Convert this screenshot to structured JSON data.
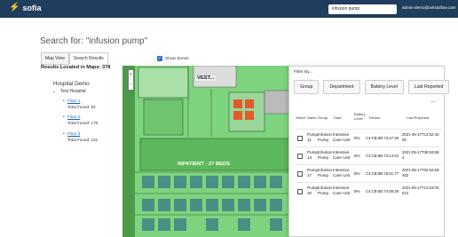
{
  "app": {
    "logo": "sofia",
    "search_value": "infusion pump",
    "user_email": "admin-demo@airistaflow.com"
  },
  "page": {
    "heading": "Search for: \"infusion pump\"",
    "tabs": [
      "Map View",
      "Search Results"
    ],
    "results_located": "Results Located in Maps: 378"
  },
  "tree": {
    "root": "Hospital Demo",
    "hospital": "Test Hospital",
    "floors": [
      {
        "label": "Floor 1",
        "total": "Total Found: 92"
      },
      {
        "label": "Floor 2",
        "total": "Total Found: 170"
      },
      {
        "label": "Floor 3",
        "total": "Total Found: 116"
      }
    ]
  },
  "map": {
    "show_zones_label": "Show Zones",
    "zoom_in": "+",
    "zoom_out": "−",
    "zone_labels": [
      "VEST...",
      "INPATIENT - 27 BEDS"
    ],
    "zone_color": "#7ed47e"
  },
  "panel": {
    "filter_by": "Filter By...",
    "filter_buttons": [
      "Group",
      "Department",
      "Battery Level",
      "Last Reported"
    ],
    "more": "...",
    "columns": [
      "Select",
      "Name",
      "Group",
      "Dept.",
      "Battery Level",
      "Device",
      "Last Reported"
    ],
    "rows": [
      {
        "name": "Pump 11",
        "group": "Infusion Pump",
        "dept": "Intensive Care Unit",
        "battery": "5%",
        "device": "C4:CB:6B:74:47:49",
        "reported": "2021-05-17T13:52:40.05"
      },
      {
        "name": "Pump 14",
        "group": "Infusion Pump",
        "dept": "Intensive Care Unit",
        "battery": "5%",
        "device": "C4:CB:6B:73:14:04",
        "reported": "2021-05-17T08:53:58.3"
      },
      {
        "name": "Pump 17",
        "group": "Infusion Pump",
        "dept": "Intensive Care Unit",
        "battery": "5%",
        "device": "C4:CB:6B:78:41:77",
        "reported": "2021-05-17T04:52:59.453"
      },
      {
        "name": "Pump 20",
        "group": "Infusion Pump",
        "dept": "Intensive Care Unit",
        "battery": "5%",
        "device": "C4:CB:6B:74:59:39",
        "reported": "2021-05-17T13:53:00.013"
      }
    ]
  }
}
